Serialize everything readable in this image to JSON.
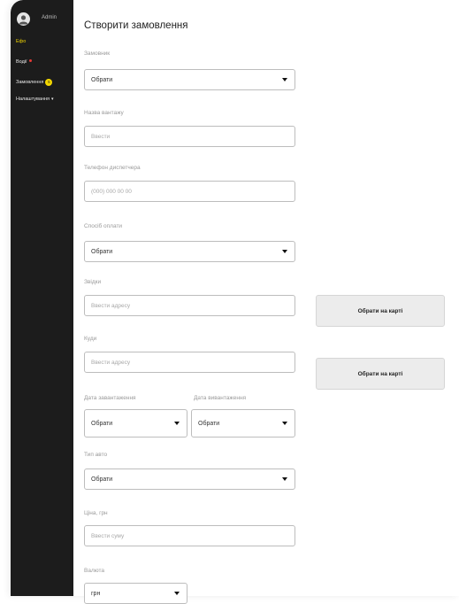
{
  "sidebar": {
    "admin_name": "Admin",
    "items": [
      {
        "label": "Ефо",
        "active": true
      },
      {
        "label": "Водії"
      },
      {
        "label": "Замовлення",
        "badge": "5"
      },
      {
        "label": "Налаштування"
      }
    ]
  },
  "page_title": "Створити замовлення",
  "form": {
    "customer": {
      "label": "Замовник",
      "value": "Обрати"
    },
    "cargo_name": {
      "label": "Назва вантажу",
      "placeholder": "Ввести"
    },
    "dispatcher_phone": {
      "label": "Телефон диспетчера",
      "placeholder": "(000) 000 00 00"
    },
    "payment_method": {
      "label": "Спосіб оплати",
      "value": "Обрати"
    },
    "from": {
      "label": "Звідки",
      "placeholder": "Ввести адресу",
      "map_button": "Обрати на карті"
    },
    "to": {
      "label": "Куди",
      "placeholder": "Ввести адресу",
      "map_button": "Обрати на карті"
    },
    "load_date": {
      "label": "Дата завантаження",
      "value": "Обрати"
    },
    "unload_date": {
      "label": "Дата вивантаження",
      "value": "Обрати"
    },
    "vehicle_type": {
      "label": "Тип авто",
      "value": "Обрати"
    },
    "price": {
      "label": "Ціна, грн",
      "placeholder": "Ввести суму"
    },
    "currency": {
      "label": "Валюта",
      "value": "грн"
    }
  },
  "colors": {
    "sidebar_bg": "#1c1c1c",
    "accent": "#f4d800",
    "alert": "#e53935"
  }
}
